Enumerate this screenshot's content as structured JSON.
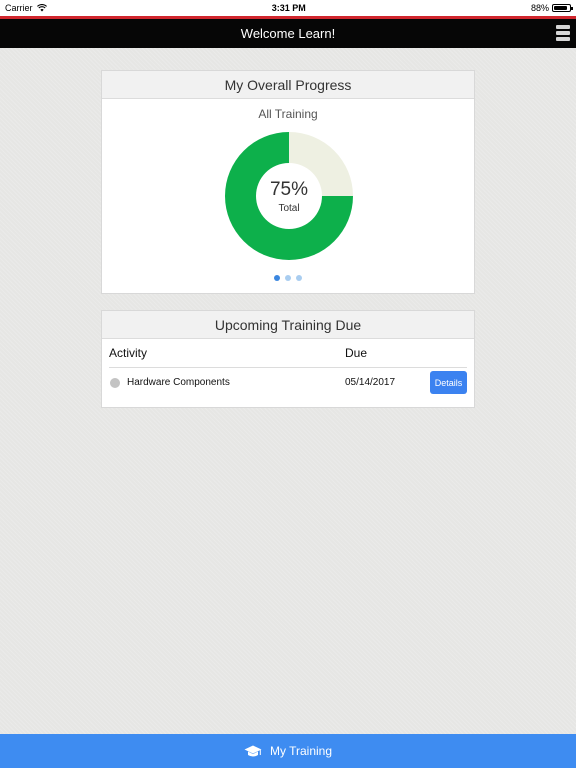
{
  "status_bar": {
    "carrier": "Carrier",
    "time": "3:31 PM",
    "battery": "88%",
    "battery_level": 0.88
  },
  "nav": {
    "title": "Welcome Learn!",
    "menu_icon": "hamburger-menu-icon"
  },
  "progress_card": {
    "title": "My Overall Progress",
    "subtitle": "All Training",
    "percent_text": "75%",
    "center_label": "Total",
    "completed_fraction": 0.75,
    "completed_color": "#0db04b",
    "remaining_color": "#eef0e2",
    "page_dots": 3,
    "active_dot": 0
  },
  "due_card": {
    "title": "Upcoming Training Due",
    "columns": [
      "Activity",
      "Due"
    ],
    "rows": [
      {
        "activity": "Hardware Components",
        "due": "05/14/2017",
        "action": "Details"
      }
    ]
  },
  "tab_bar": {
    "label": "My Training",
    "icon": "graduation-cap-icon"
  },
  "colors": {
    "accent": "#3b82f0",
    "nav_background": "#060606",
    "top_stripe": "#d0262d"
  }
}
